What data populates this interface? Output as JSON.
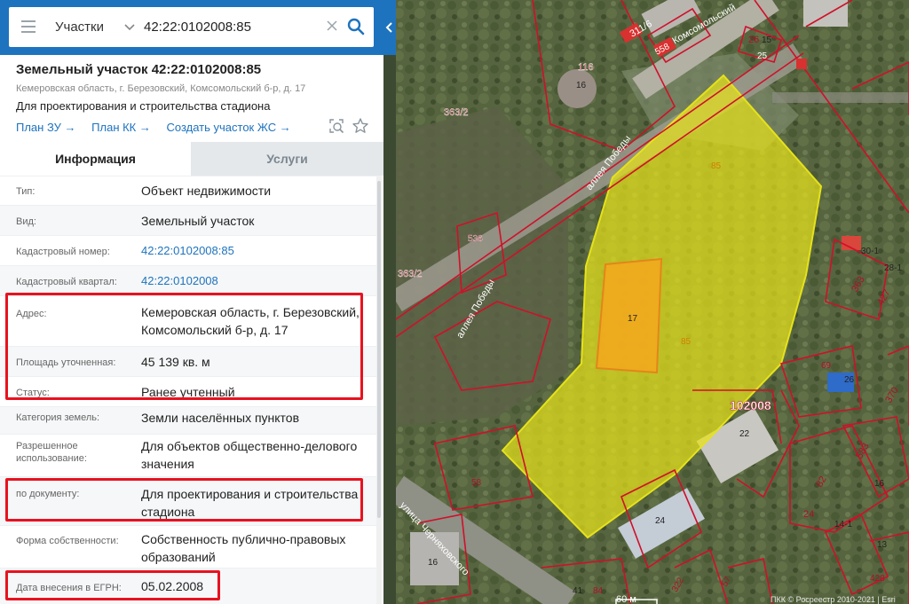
{
  "search": {
    "layer": "Участки",
    "query": "42:22:0102008:85"
  },
  "parcel": {
    "title": "Земельный участок 42:22:0102008:85",
    "address": "Кемеровская область, г. Березовский, Комсомольский б-р, д. 17",
    "purpose": "Для проектирования и строительства стадиона"
  },
  "links": {
    "plan_zu": "План ЗУ →",
    "plan_kk": "План КК →",
    "create": "Создать участок ЖС →"
  },
  "tabs": {
    "info": "Информация",
    "services": "Услуги"
  },
  "info": {
    "type_label": "Тип:",
    "type_value": "Объект недвижимости",
    "kind_label": "Вид:",
    "kind_value": "Земельный участок",
    "cadnum_label": "Кадастровый номер:",
    "cadnum_value": "42:22:0102008:85",
    "quarter_label": "Кадастровый квартал:",
    "quarter_value": "42:22:0102008",
    "address_label": "Адрес:",
    "address_value_line1": "Кемеровская область, г. Березовский,",
    "address_value_line2": "Комсомольский б-р, д. 17",
    "area_label": "Площадь уточненная:",
    "area_value": "45 139 кв. м",
    "status_label": "Статус:",
    "status_value": "Ранее учтенный",
    "category_label": "Категория земель:",
    "category_value": "Земли населённых пунктов",
    "use_label_line1": "Разрешенное",
    "use_label_line2": "использование:",
    "use_value_line1": "Для объектов общественно-делового",
    "use_value_line2": "значения",
    "doc_label": "по документу:",
    "doc_value_line1": "Для проектирования и строительства",
    "doc_value_line2": "стадиона",
    "ownership_label": "Форма собственности:",
    "ownership_value_line1": "Собственность публично-правовых",
    "ownership_value_line2": "образований",
    "egrn_label": "Дата внесения в ЕГРН:",
    "egrn_value": "05.02.2008"
  },
  "map": {
    "labels": {
      "l_311_6": "311/6",
      "l_558": "558",
      "l_komsomol": "Комсомольский",
      "l_26": "26",
      "l_15": "15",
      "l_25": "25",
      "l_116": "116",
      "l_16a": "16",
      "l_363_2a": "363/2",
      "l_85a": "85",
      "l_alleya_top": "аллея Победы",
      "l_536": "536",
      "l_363_2b": "363/2",
      "l_alleya_bot": "аллея Победы",
      "l_17": "17",
      "l_85b": "85",
      "l_30_1": "30-1",
      "l_28_1": "28-1",
      "l_363": "363",
      "l_427": "427",
      "l_69": "69",
      "l_26b": "26",
      "l_370": "370",
      "l_102008": "102008",
      "l_22": "22",
      "l_583": "583",
      "l_58": "58",
      "l_82": "82",
      "l_16b": "16",
      "l_24a": "24",
      "l_24b": "24",
      "l_14_1": "14-1",
      "l_13": "13",
      "l_street": "улица Черняховского",
      "l_16c": "16",
      "l_428": "428",
      "l_41": "41",
      "l_84": "84",
      "l_60m": "60 м",
      "l_322": "322",
      "l_57": "57",
      "l_copy": "ПКК © Росреестр 2010-2021 | Esri"
    }
  },
  "colors": {
    "accent": "#1e73be",
    "highlight": "#e8121f",
    "parcel_fill": "#e6e21a",
    "building_fill": "#f2a81e",
    "boundary": "#d0102a"
  }
}
